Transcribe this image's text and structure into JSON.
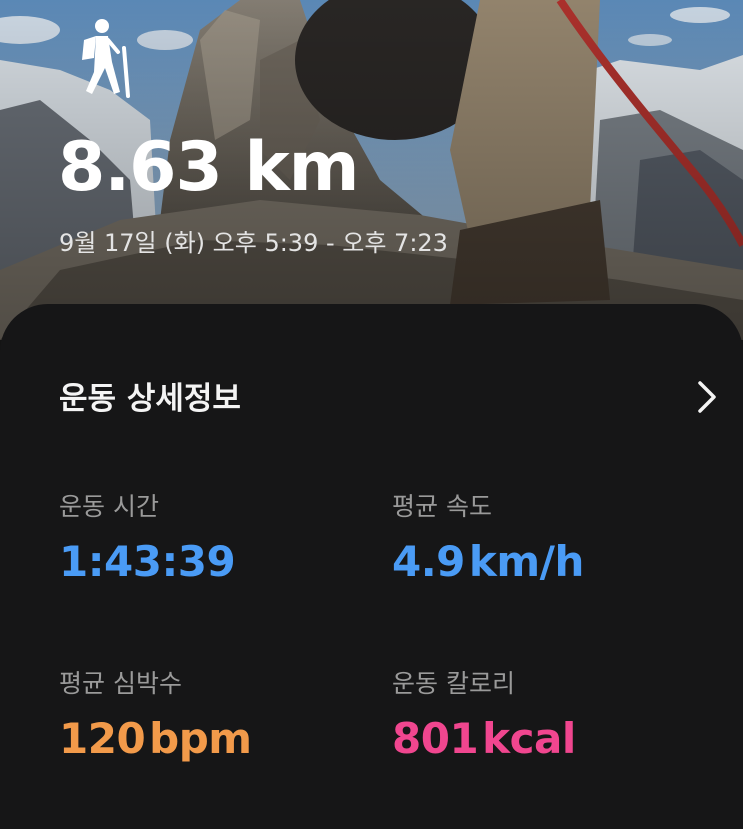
{
  "hero": {
    "activity_icon": "hiking-icon",
    "distance": "8.63 km",
    "datetime": "9월 17일 (화) 오후 5:39 - 오후 7:23"
  },
  "details": {
    "title": "운동 상세정보",
    "chevron_icon": "chevron-right-icon",
    "stats": [
      {
        "label": "운동 시간",
        "value": "1:43:39",
        "unit": "",
        "color": "#4a9bf5"
      },
      {
        "label": "평균 속도",
        "value": "4.9",
        "unit": "km/h",
        "color": "#4a9bf5"
      },
      {
        "label": "평균 심박수",
        "value": "120",
        "unit": "bpm",
        "color": "#f29a4a"
      },
      {
        "label": "운동 칼로리",
        "value": "801",
        "unit": "kcal",
        "color": "#f0468f"
      }
    ]
  },
  "colors": {
    "card_background": "#161617",
    "label_gray": "#9a9a9a",
    "blue": "#4a9bf5",
    "orange": "#f29a4a",
    "pink": "#f0468f"
  }
}
